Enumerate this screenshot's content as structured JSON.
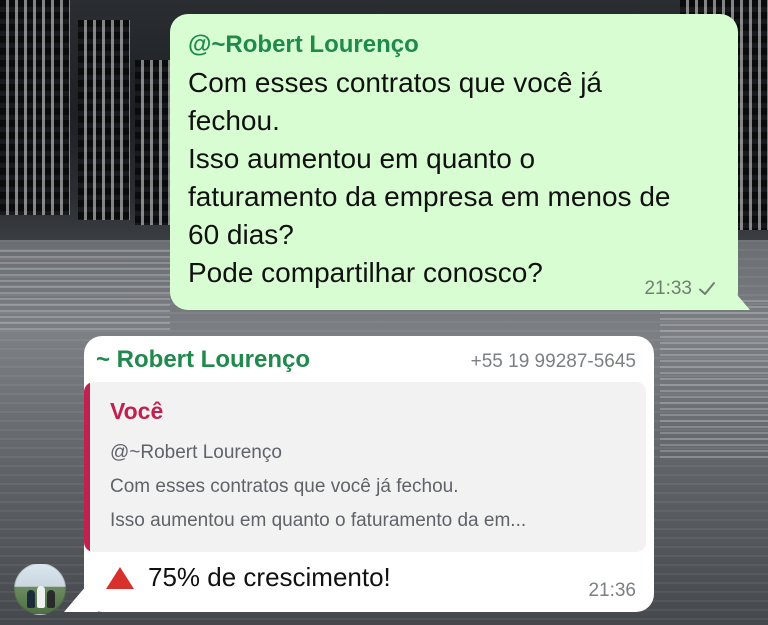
{
  "outgoing_message": {
    "mention": "@~Robert Lourenço",
    "text": "Com esses contratos que você já\nfechou.\nIsso aumentou em quanto o\nfaturamento da empresa em menos de\n60 dias?\nPode compartilhar conosco?",
    "time": "21:33",
    "status_icon": "single-check-icon"
  },
  "incoming_message": {
    "sender_name": "~ Robert Lourenço",
    "sender_phone": "+55 19 99287-5645",
    "quoted": {
      "author": "Você",
      "line1": "@~Robert Lourenço",
      "line2": "Com esses contratos que você já fechou.",
      "line3": "Isso aumentou em quanto o faturamento da em..."
    },
    "emoji_icon": "red-triangle-up-icon",
    "text": "75% de crescimento!",
    "time": "21:36"
  },
  "avatar": {
    "icon": "group-photo-avatar"
  },
  "colors": {
    "outgoing_bubble": "#d9fdd3",
    "incoming_bubble": "#ffffff",
    "sender_green": "#1f8a4c",
    "quote_accent": "#c1214f"
  }
}
